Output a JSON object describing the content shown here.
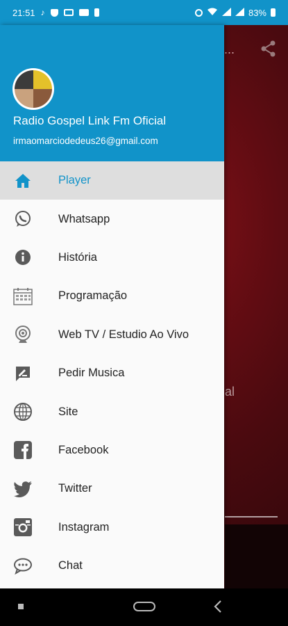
{
  "status_bar": {
    "time": "21:51",
    "battery": "83%",
    "icons_left": [
      "music-note-icon",
      "shield-icon",
      "monitor-icon",
      "youtube-icon",
      "battery-saver-icon"
    ],
    "icons_right": [
      "alarm-icon",
      "wifi-icon",
      "signal-icon",
      "signal-icon",
      "battery-icon"
    ]
  },
  "background_app": {
    "title_fragment": "í...",
    "body_fragment": "al"
  },
  "drawer": {
    "header": {
      "name": "Radio Gospel Link Fm Oficial",
      "email": "irmaomarciodedeus26@gmail.com"
    },
    "items": [
      {
        "label": "Player",
        "icon": "home-icon",
        "active": true
      },
      {
        "label": "Whatsapp",
        "icon": "whatsapp-icon",
        "active": false
      },
      {
        "label": "História",
        "icon": "info-icon",
        "active": false
      },
      {
        "label": "Programação",
        "icon": "calendar-icon",
        "active": false
      },
      {
        "label": "Web TV / Estudio Ao Vivo",
        "icon": "webcam-icon",
        "active": false
      },
      {
        "label": "Pedir Musica",
        "icon": "request-icon",
        "active": false
      },
      {
        "label": "Site",
        "icon": "globe-icon",
        "active": false
      },
      {
        "label": "Facebook",
        "icon": "facebook-icon",
        "active": false
      },
      {
        "label": "Twitter",
        "icon": "twitter-icon",
        "active": false
      },
      {
        "label": "Instagram",
        "icon": "instagram-icon",
        "active": false
      },
      {
        "label": "Chat",
        "icon": "chat-icon",
        "active": false
      }
    ]
  },
  "colors": {
    "accent": "#1193c9",
    "icon_gray": "#5a5a5a",
    "active_bg": "#dedede"
  }
}
